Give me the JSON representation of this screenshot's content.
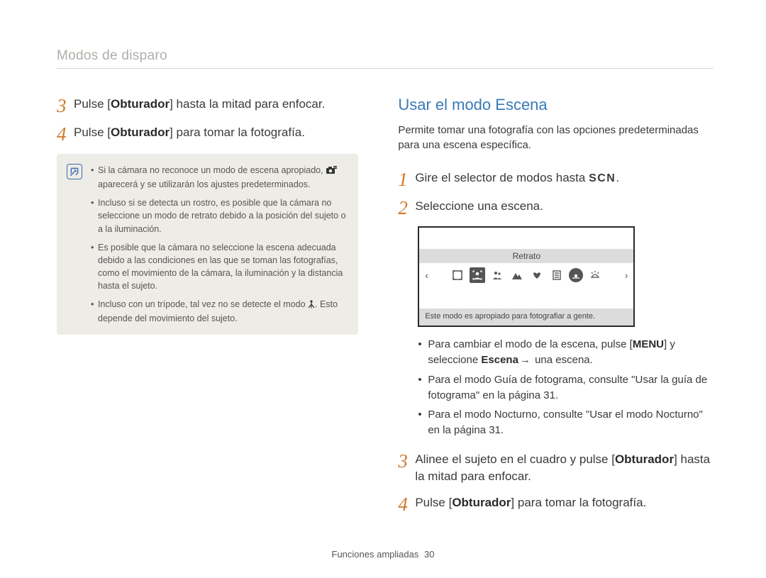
{
  "header": {
    "breadcrumb": "Modos de disparo"
  },
  "left": {
    "step3": {
      "num": "3",
      "before": "Pulse [",
      "bold": "Obturador",
      "after": "] hasta la mitad para enfocar."
    },
    "step4": {
      "num": "4",
      "before": "Pulse [",
      "bold": "Obturador",
      "after": "] para tomar la fotografía."
    },
    "info": {
      "b1a": "Si la cámara no reconoce un modo de escena apropiado, ",
      "b1b": " aparecerá y se utilizarán los ajustes predeterminados.",
      "b2": "Incluso si se detecta un rostro, es posible que la cámara no seleccione un modo de retrato debido a la posición del sujeto o a la iluminación.",
      "b3": "Es posible que la cámara no seleccione la escena adecuada debido a las condiciones en las que se toman las fotografías, como el movimiento de la cámara, la iluminación y la distancia hasta el sujeto.",
      "b4a": "Incluso con un trípode, tal vez no se detecte el modo ",
      "b4b": ". Esto depende del movimiento del sujeto."
    }
  },
  "right": {
    "title": "Usar el modo Escena",
    "intro": "Permite tomar una fotografía con las opciones predeterminadas para una escena específica.",
    "step1": {
      "num": "1",
      "before": "Gire el selector de modos hasta ",
      "scn": "SCN",
      "after": "."
    },
    "step2": {
      "num": "2",
      "text": "Seleccione una escena."
    },
    "screen": {
      "label": "Retrato",
      "desc": "Este modo es apropiado para fotografiar a gente.",
      "icons": {
        "i1": "frame-guide-icon",
        "i2": "portrait-icon",
        "i3": "children-icon",
        "i4": "landscape-icon",
        "i5": "closeup-icon",
        "i6": "text-icon",
        "i7": "sunset-icon",
        "i8": "dawn-icon"
      }
    },
    "sub": {
      "s1a": "Para cambiar el modo de la escena, pulse [",
      "s1b": "MENU",
      "s1c": "] y seleccione ",
      "s1d": "Escena",
      "s1e": " una escena.",
      "s2": "Para el modo Guía de fotograma, consulte \"Usar la guía de fotograma\" en la página 31.",
      "s3": "Para el modo Nocturno, consulte \"Usar el modo Nocturno\" en la página 31."
    },
    "step3": {
      "num": "3",
      "before": "Alinee el sujeto en el cuadro y pulse [",
      "bold": "Obturador",
      "after": "] hasta la mitad para enfocar."
    },
    "step4": {
      "num": "4",
      "before": "Pulse [",
      "bold": "Obturador",
      "after": "] para tomar la fotografía."
    }
  },
  "footer": {
    "section": "Funciones ampliadas",
    "page": "30"
  }
}
